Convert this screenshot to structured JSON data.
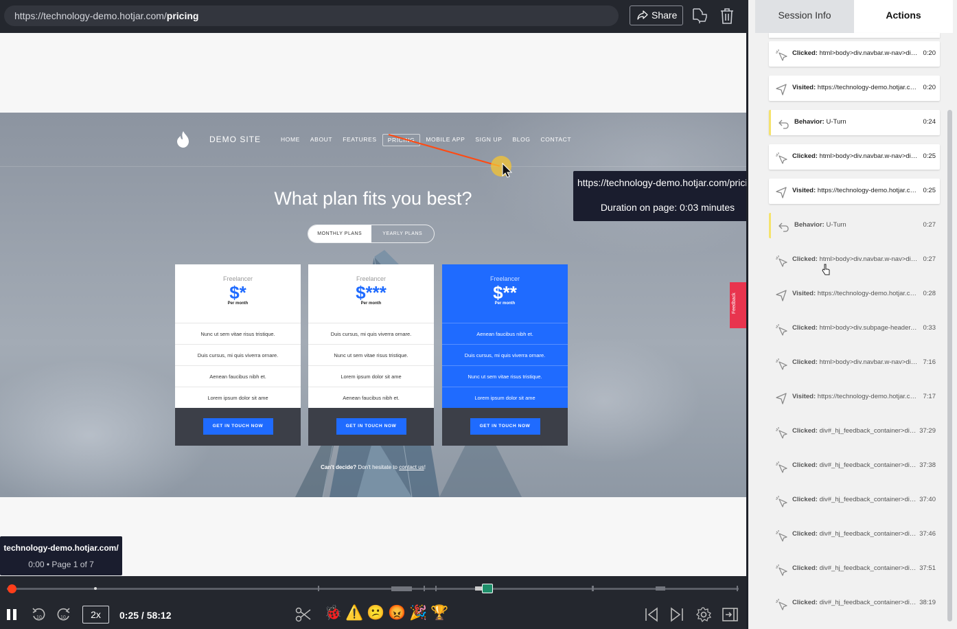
{
  "topbar": {
    "url_prefix": "https://technology-demo.hotjar.com/",
    "url_path": "pricing",
    "share_label": "Share",
    "share_icon": "share-icon",
    "favorite_icon": "thumbs-icon",
    "delete_icon": "trash-icon"
  },
  "site": {
    "brand": "DEMO SITE",
    "nav": [
      {
        "label": "HOME",
        "active": false
      },
      {
        "label": "ABOUT",
        "active": false
      },
      {
        "label": "FEATURES",
        "active": false
      },
      {
        "label": "PRICING",
        "active": true
      },
      {
        "label": "MOBILE APP",
        "active": false
      },
      {
        "label": "SIGN UP",
        "active": false
      },
      {
        "label": "BLOG",
        "active": false
      },
      {
        "label": "CONTACT",
        "active": false
      }
    ],
    "headline": "What plan fits you best?",
    "plan_toggle": {
      "monthly": "MONTHLY PLANS",
      "yearly": "YEARLY PLANS"
    },
    "cards": [
      {
        "tier": "Freelancer",
        "price": "$*",
        "per": "Per month",
        "features": [
          "Nunc ut sem vitae risus tristique.",
          "Duis cursus, mi quis viverra ornare.",
          "Aenean faucibus nibh et.",
          "Lorem ipsum dolor sit ame"
        ],
        "cta": "GET IN TOUCH NOW",
        "highlight": false
      },
      {
        "tier": "Freelancer",
        "price": "$***",
        "per": "Per month",
        "features": [
          "Duis cursus, mi quis viverra ornare.",
          "Nunc ut sem vitae risus tristique.",
          "Lorem ipsum dolor sit ame",
          "Aenean faucibus nibh et."
        ],
        "cta": "GET IN TOUCH NOW",
        "highlight": false
      },
      {
        "tier": "Freelancer",
        "price": "$**",
        "per": "Per month",
        "features": [
          "Aenean faucibus nibh et.",
          "Duis cursus, mi quis viverra ornare.",
          "Nunc ut sem vitae risus tristique.",
          "Lorem ipsum dolor sit ame"
        ],
        "cta": "GET IN TOUCH NOW",
        "highlight": true
      }
    ],
    "cant_decide_bold": "Can't decide?",
    "cant_decide_text": " Don't hesitate to ",
    "contact_link": "contact us",
    "cant_decide_end": "!",
    "feedback_tab": "Feedback"
  },
  "tooltip": {
    "url": "https://technology-demo.hotjar.com/pricing",
    "duration": "Duration on page: 0:03 minutes"
  },
  "page_tip": {
    "domain": "technology-demo.hotjar.com/",
    "info": "0:00 • Page 1 of 7"
  },
  "player": {
    "progress": 0.007,
    "speed": "2x",
    "time": "0:25 / 58:12",
    "icons": [
      "pause-icon",
      "rewind-10-icon",
      "forward-10-icon",
      "scissors-icon",
      "bug-icon",
      "warning-icon",
      "confused-face-icon",
      "angry-face-icon",
      "party-popper-icon",
      "trophy-icon",
      "previous-page-icon",
      "next-page-icon",
      "settings-icon",
      "exit-fullscreen-icon"
    ],
    "reactions": [
      "🐞",
      "⚠️",
      "😕",
      "😡",
      "🎉",
      "🏆"
    ]
  },
  "panel": {
    "tabs": [
      {
        "label": "Session Info",
        "active": false
      },
      {
        "label": "Actions",
        "active": true
      }
    ],
    "actions": [
      {
        "type": "click",
        "kind": "Clicked:",
        "target": "html>body>div.navbar.w-nav>div.container.w-container>nav.nav-menu.w-nav-menu>a.nav-link",
        "time": "0:20",
        "muted": false
      },
      {
        "type": "visit",
        "kind": "Visited:",
        "target": "https://technology-demo.hotjar.com/pricing",
        "time": "0:20",
        "muted": false
      },
      {
        "type": "behavior",
        "kind": "Behavior:",
        "target": "U-Turn",
        "time": "0:24",
        "muted": false
      },
      {
        "type": "click",
        "kind": "Clicked:",
        "target": "html>body>div.navbar.w-nav>div.container.w-container>nav.nav-menu.w-nav-menu>a.nav-link",
        "time": "0:25",
        "muted": false
      },
      {
        "type": "visit",
        "kind": "Visited:",
        "target": "https://technology-demo.hotjar.com/pricing",
        "time": "0:25",
        "muted": false
      },
      {
        "type": "behavior",
        "kind": "Behavior:",
        "target": "U-Turn",
        "time": "0:27",
        "muted": true
      },
      {
        "type": "click",
        "kind": "Clicked:",
        "target": "html>body>div.navbar.w-nav>div.container.w-container>nav.nav-menu.w-nav-menu>a.nav-link",
        "time": "0:27",
        "muted": true
      },
      {
        "type": "visit",
        "kind": "Visited:",
        "target": "https://technology-demo.hotjar.com/pricing",
        "time": "0:28",
        "muted": true
      },
      {
        "type": "click",
        "kind": "Clicked:",
        "target": "html>body>div.subpage-header.section>div.container.w-container",
        "time": "0:33",
        "muted": true
      },
      {
        "type": "click",
        "kind": "Clicked:",
        "target": "html>body>div.navbar.w-nav>div.container.w-container>nav.nav-menu.w-nav-menu>a.nav-link",
        "time": "7:16",
        "muted": true
      },
      {
        "type": "visit",
        "kind": "Visited:",
        "target": "https://technology-demo.hotjar.com/pricing",
        "time": "7:17",
        "muted": true
      },
      {
        "type": "click",
        "kind": "Clicked:",
        "target": "div#_hj_feedback_container>div._hj-feedback",
        "time": "37:29",
        "muted": true
      },
      {
        "type": "click",
        "kind": "Clicked:",
        "target": "div#_hj_feedback_container>div._hj-feedback",
        "time": "37:38",
        "muted": true
      },
      {
        "type": "click",
        "kind": "Clicked:",
        "target": "div#_hj_feedback_container>div._hj-feedback",
        "time": "37:40",
        "muted": true
      },
      {
        "type": "click",
        "kind": "Clicked:",
        "target": "div#_hj_feedback_container>div._hj-feedback",
        "time": "37:46",
        "muted": true
      },
      {
        "type": "click",
        "kind": "Clicked:",
        "target": "div#_hj_feedback_container>div._hj-feedback",
        "time": "37:51",
        "muted": true
      },
      {
        "type": "click",
        "kind": "Clicked:",
        "target": "div#_hj_feedback_container>div._hj-feedback",
        "time": "38:19",
        "muted": true
      }
    ]
  },
  "colors": {
    "accent": "#1f6bff",
    "playhead": "#ff3e1a",
    "behavior_marker": "#f5e36c",
    "feedback": "#e8344e"
  }
}
